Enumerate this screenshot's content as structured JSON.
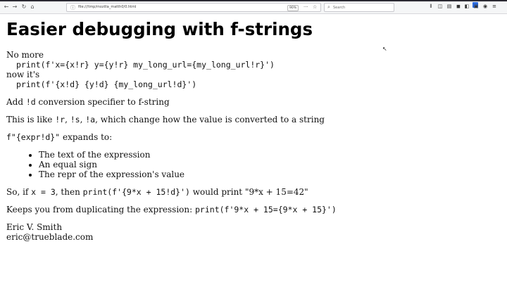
{
  "browser": {
    "nav": {
      "back": "←",
      "forward": "→",
      "reload": "↻",
      "home": "⌂"
    },
    "url": "file:///tmp/mozilla_matth0/0.html",
    "zoom": "90%",
    "url_actions": {
      "more": "···",
      "bookmark": "☆"
    },
    "search_placeholder": "Search",
    "toolbar_icons": [
      "library-icon",
      "sidebar-icon",
      "reader-icon",
      "screenshot-icon",
      "extension-icon",
      "extension-icon-2",
      "account-icon",
      "menu-icon"
    ]
  },
  "page": {
    "title": "Easier debugging with f-strings",
    "no_more": "No more",
    "old_code": "print(f'x={x!r} y={y!r} my_long_url={my_long_url!r}')",
    "now_its": "now it's",
    "new_code": "print(f'{x!d} {y!d} {my_long_url!d}')",
    "add_pre": "Add ",
    "add_code": "!d",
    "add_post": " conversion specifier to f-string",
    "like_pre": "This is like ",
    "like_r": "!r",
    "like_sep1": ", ",
    "like_s": "!s",
    "like_sep2": ", ",
    "like_a": "!a",
    "like_post": ", which change how the value is converted to a string",
    "expands_code": "f\"{expr!d}\"",
    "expands_post": " expands to:",
    "bullets": [
      "The text of the expression",
      "An equal sign",
      "The repr of the expression's value"
    ],
    "so_pre": "So, if ",
    "so_code1": "x = 3",
    "so_mid": ", then ",
    "so_code2": "print(f'{9*x + 15!d}')",
    "so_post": " would print \"9*x + 15=42\"",
    "keeps_pre": "Keeps you from duplicating the expression: ",
    "keeps_code": "print(f'9*x + 15={9*x + 15}')",
    "author": "Eric V. Smith",
    "email": "eric@trueblade.com"
  }
}
